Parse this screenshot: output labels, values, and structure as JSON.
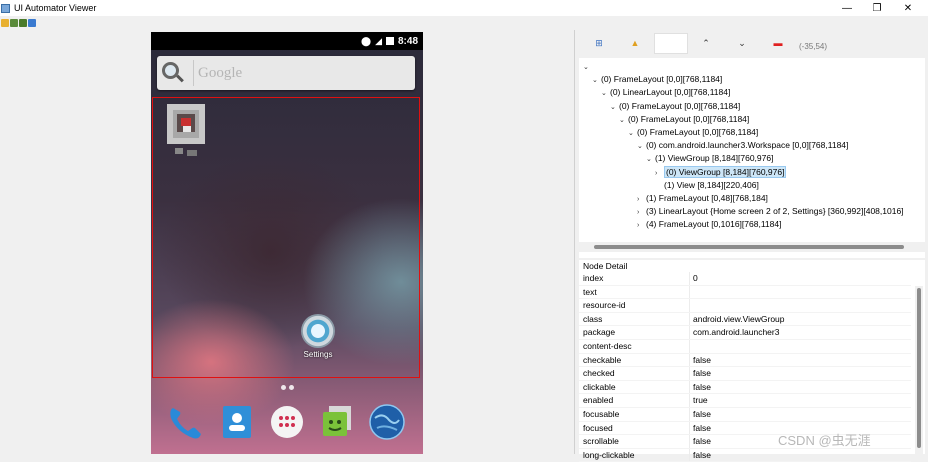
{
  "window": {
    "title": "UI Automator Viewer",
    "minimize": "—",
    "restore": "❐",
    "close": "✕"
  },
  "device": {
    "status_time": "8:48",
    "search_placeholder": "Google",
    "settings_label": "Settings"
  },
  "inspector": {
    "coords": "(-35,54)",
    "tree": [
      {
        "indent": 0,
        "toggle": "⌄",
        "label": ""
      },
      {
        "indent": 1,
        "toggle": "⌄",
        "label": "(0) FrameLayout [0,0][768,1184]"
      },
      {
        "indent": 2,
        "toggle": "⌄",
        "label": "(0) LinearLayout [0,0][768,1184]"
      },
      {
        "indent": 3,
        "toggle": "⌄",
        "label": "(0) FrameLayout [0,0][768,1184]"
      },
      {
        "indent": 4,
        "toggle": "⌄",
        "label": "(0) FrameLayout [0,0][768,1184]"
      },
      {
        "indent": 5,
        "toggle": "⌄",
        "label": "(0) FrameLayout [0,0][768,1184]"
      },
      {
        "indent": 6,
        "toggle": "⌄",
        "label": "(0) com.android.launcher3.Workspace [0,0][768,1184]"
      },
      {
        "indent": 7,
        "toggle": "⌄",
        "label": "(1) ViewGroup [8,184][760,976]"
      },
      {
        "indent": 8,
        "toggle": "›",
        "label": "(0) ViewGroup [8,184][760,976]",
        "selected": true
      },
      {
        "indent": 8,
        "toggle": "",
        "label": "(1) View [8,184][220,406]"
      },
      {
        "indent": 6,
        "toggle": "›",
        "label": "(1) FrameLayout [0,48][768,184]"
      },
      {
        "indent": 6,
        "toggle": "›",
        "label": "(3) LinearLayout {Home screen 2 of 2, Settings} [360,992][408,1016]"
      },
      {
        "indent": 6,
        "toggle": "›",
        "label": "(4) FrameLayout [0,1016][768,1184]"
      }
    ],
    "detail_title": "Node Detail",
    "details": [
      {
        "key": "index",
        "value": "0"
      },
      {
        "key": "text",
        "value": ""
      },
      {
        "key": "resource-id",
        "value": ""
      },
      {
        "key": "class",
        "value": "android.view.ViewGroup"
      },
      {
        "key": "package",
        "value": "com.android.launcher3"
      },
      {
        "key": "content-desc",
        "value": ""
      },
      {
        "key": "checkable",
        "value": "false"
      },
      {
        "key": "checked",
        "value": "false"
      },
      {
        "key": "clickable",
        "value": "false"
      },
      {
        "key": "enabled",
        "value": "true"
      },
      {
        "key": "focusable",
        "value": "false"
      },
      {
        "key": "focused",
        "value": "false"
      },
      {
        "key": "scrollable",
        "value": "false"
      },
      {
        "key": "long-clickable",
        "value": "false"
      }
    ]
  },
  "watermark": "CSDN @虫无涯"
}
